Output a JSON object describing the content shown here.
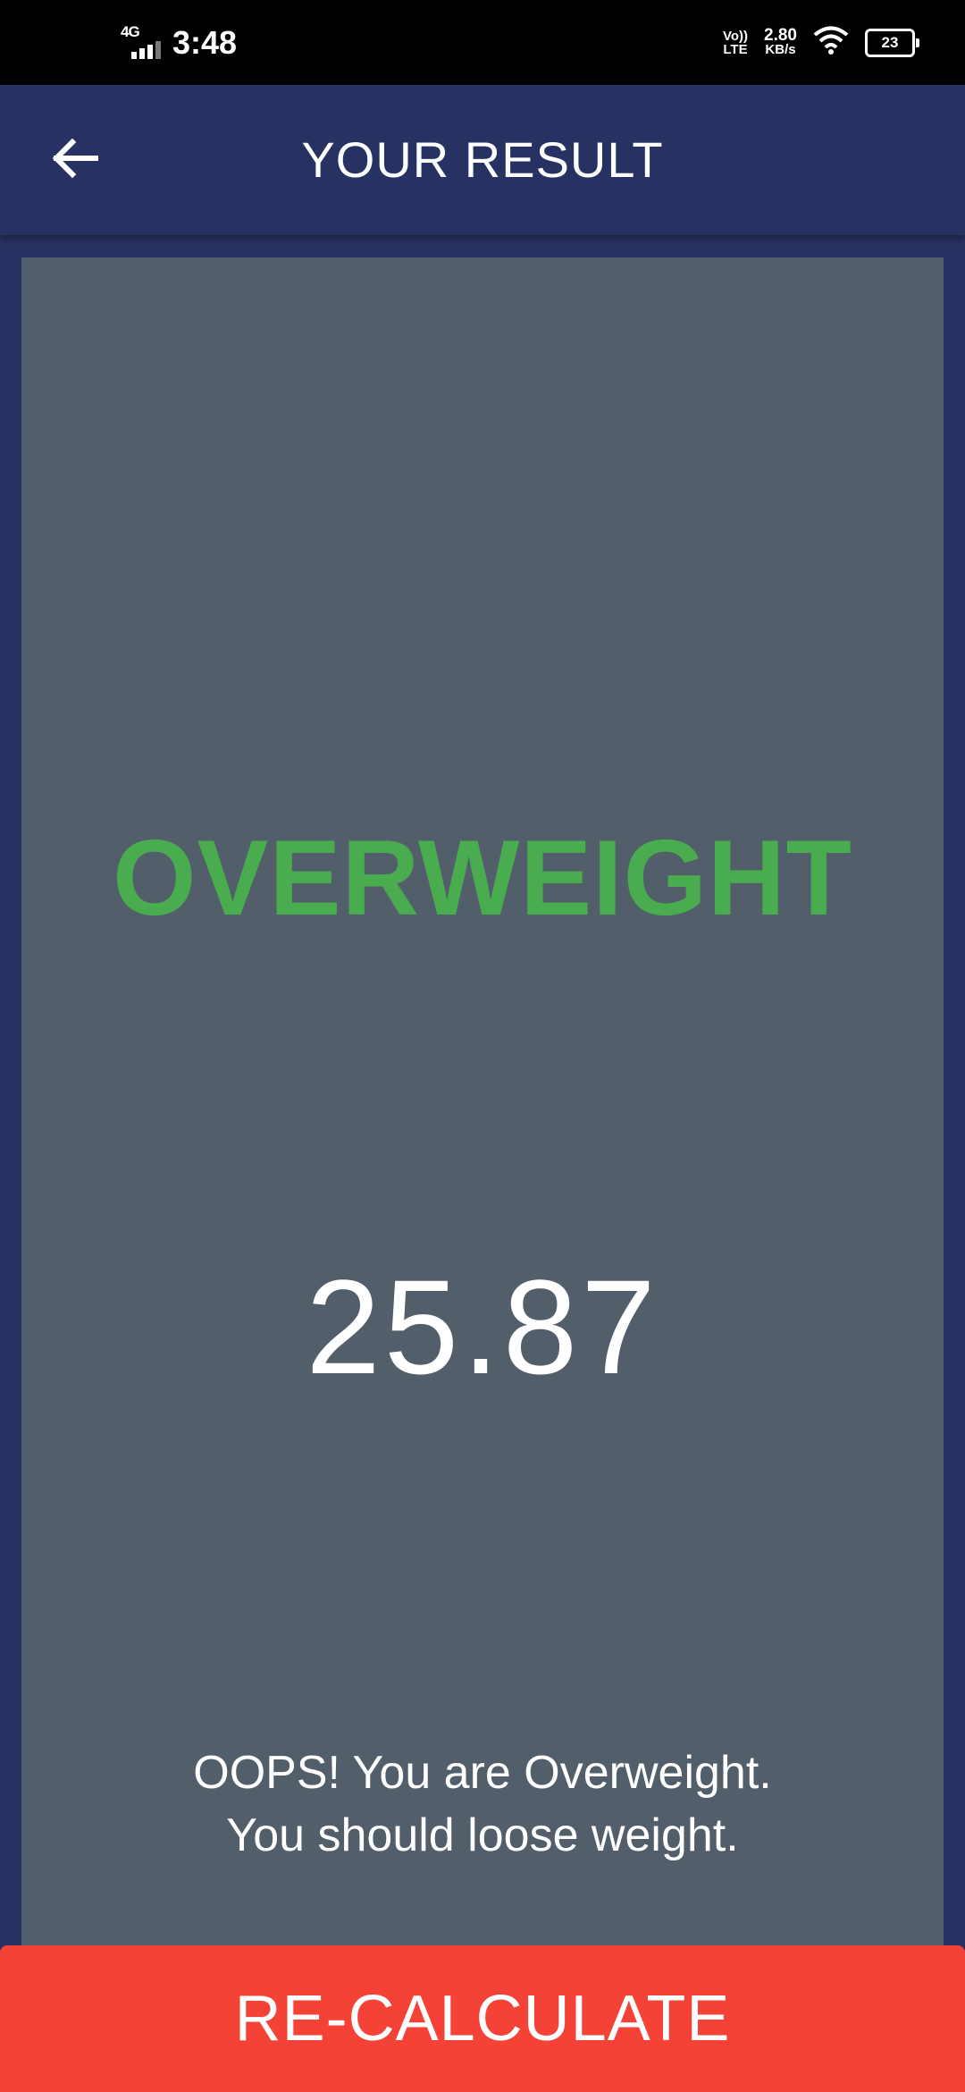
{
  "status_bar": {
    "network": "4G",
    "time": "3:48",
    "volte_top": "Vo))",
    "volte_bottom": "LTE",
    "speed_value": "2.80",
    "speed_unit": "KB/s",
    "battery": "23"
  },
  "app_bar": {
    "title": "YOUR RESULT",
    "back_icon": "arrow-left-icon"
  },
  "result": {
    "status": "OVERWEIGHT",
    "status_color": "#49ad50",
    "bmi": "25.87",
    "message": "OOPS! You are Overweight.\n You should loose weight."
  },
  "actions": {
    "recalculate_label": "RE-CALCULATE",
    "recalculate_color": "#f44336"
  },
  "colors": {
    "primary": "#283262",
    "card": "#535e6b"
  }
}
